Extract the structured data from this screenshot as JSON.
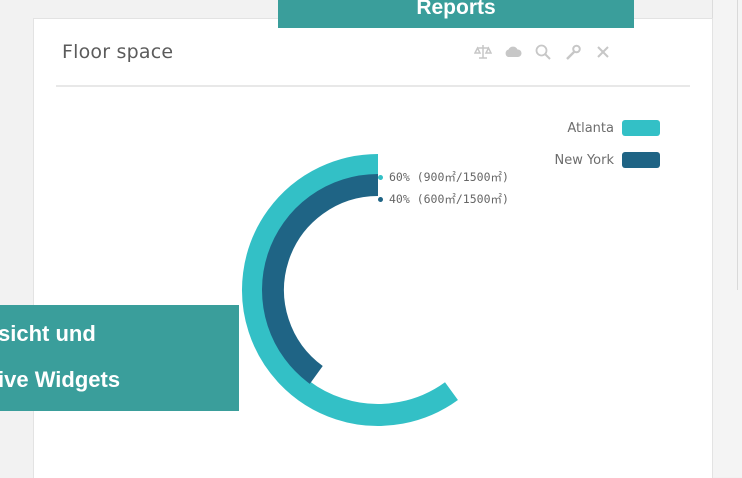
{
  "card": {
    "title": "Floor space",
    "toolbar_icons": [
      "scale-icon",
      "cloud-icon",
      "zoom-icon",
      "wrench-icon",
      "close-icon"
    ]
  },
  "banners": {
    "top": "Reports",
    "left_line1": "sicht und",
    "left_line2": "ive Widgets"
  },
  "chart_data": {
    "type": "pie",
    "variant": "radial-bar",
    "series": [
      {
        "name": "Atlanta",
        "value": 900,
        "percent": 60,
        "color": "#33c0c6"
      },
      {
        "name": "New York",
        "value": 600,
        "percent": 40,
        "color": "#1f6485"
      }
    ],
    "total": 1500,
    "unit": "m²",
    "legend_position": "top-right",
    "tooltip": [
      "60% (900㎡/1500㎡)",
      "40% (600㎡/1500㎡)"
    ]
  },
  "colors": {
    "accent": "#3a9e9b",
    "atlanta": "#33c0c6",
    "new_york": "#1f6485"
  }
}
